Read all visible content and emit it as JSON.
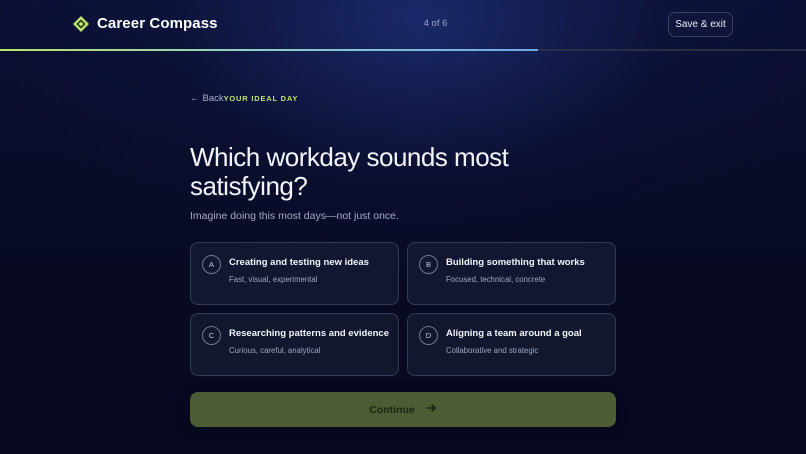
{
  "header": {
    "brand_name": "Career Compass",
    "step_text": "4 of 6",
    "save_label": "Save & exit",
    "progress_fraction": 0.667
  },
  "question": {
    "back_label": "Back",
    "eyebrow": "YOUR IDEAL DAY",
    "title": "Which workday sounds most satisfying?",
    "subtitle": "Imagine doing this most days—not just once."
  },
  "options": [
    {
      "letter": "A",
      "title": "Creating and testing new ideas",
      "desc": "Fast, visual, experimental"
    },
    {
      "letter": "B",
      "title": "Building something that works",
      "desc": "Focused, technical, concrete"
    },
    {
      "letter": "C",
      "title": "Researching patterns and evidence",
      "desc": "Curious, careful, analytical"
    },
    {
      "letter": "D",
      "title": "Aligning a team around a goal",
      "desc": "Collaborative and strategic"
    }
  ],
  "footer": {
    "continue_label": "Continue"
  },
  "colors": {
    "accent": "#b9e36a",
    "background": "#080b26",
    "continue_bg": "#4d5c35"
  }
}
